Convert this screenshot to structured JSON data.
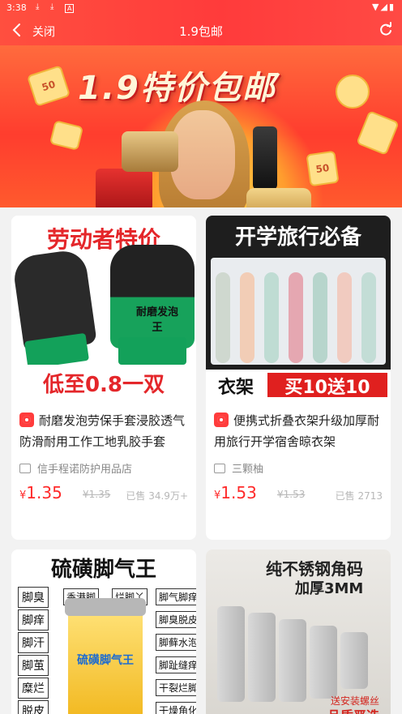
{
  "status_bar": {
    "time": "3:38",
    "notification_icons": [
      "download-icon",
      "download-icon",
      "app-icon"
    ],
    "system_icons": [
      "wifi-icon",
      "signal-icon",
      "battery-icon"
    ]
  },
  "nav": {
    "close_label": "关闭",
    "title": "1.9包邮",
    "colors": {
      "bar": "#ff4740",
      "text": "#ffffff"
    }
  },
  "banner": {
    "headline": "1.9特价包邮",
    "coupon_text": "50"
  },
  "products": [
    {
      "image_texts": {
        "top": "劳动者特价",
        "bottom": "低至0.8一双",
        "mark": "耐磨发泡王"
      },
      "name": "耐磨发泡劳保手套浸胶透气防滑耐用工作工地乳胶手套",
      "shop": "信手程诺防护用品店",
      "price_symbol": "¥",
      "price": "1.35",
      "original_price": "¥1.35",
      "sold": "已售 34.9万+"
    },
    {
      "image_texts": {
        "top": "开学旅行必备",
        "bottom_left": "衣架",
        "bottom_right": "买10送10"
      },
      "name": "便携式折叠衣架升级加厚耐用旅行开学宿舍晾衣架",
      "shop": "三颗柚",
      "price_symbol": "¥",
      "price": "1.53",
      "original_price": "¥1.53",
      "sold": "已售 2713"
    },
    {
      "image_texts": {
        "top": "硫磺脚气王",
        "labels_left": [
          "脚臭",
          "脚痒",
          "脚汗",
          "脚茧",
          "糜烂",
          "脱皮"
        ],
        "labels_mid": [
          "香港脚",
          "烂脚丫"
        ],
        "labels_right": [
          "脚气脚痒",
          "脚臭脱皮",
          "脚藓水泡",
          "脚趾缝痒",
          "干裂烂脚",
          "干燥角化"
        ],
        "jar_label": "硫磺脚气王"
      }
    },
    {
      "image_texts": {
        "top_line1": "纯不锈钢角码",
        "top_line2": "加厚3MM",
        "note_small": "送安装螺丝",
        "note_big": "品质严选"
      }
    }
  ],
  "colors": {
    "price": "#ff2a2a",
    "tmall_badge": "#ff3c3c",
    "page_bg": "#f2f2f2"
  }
}
